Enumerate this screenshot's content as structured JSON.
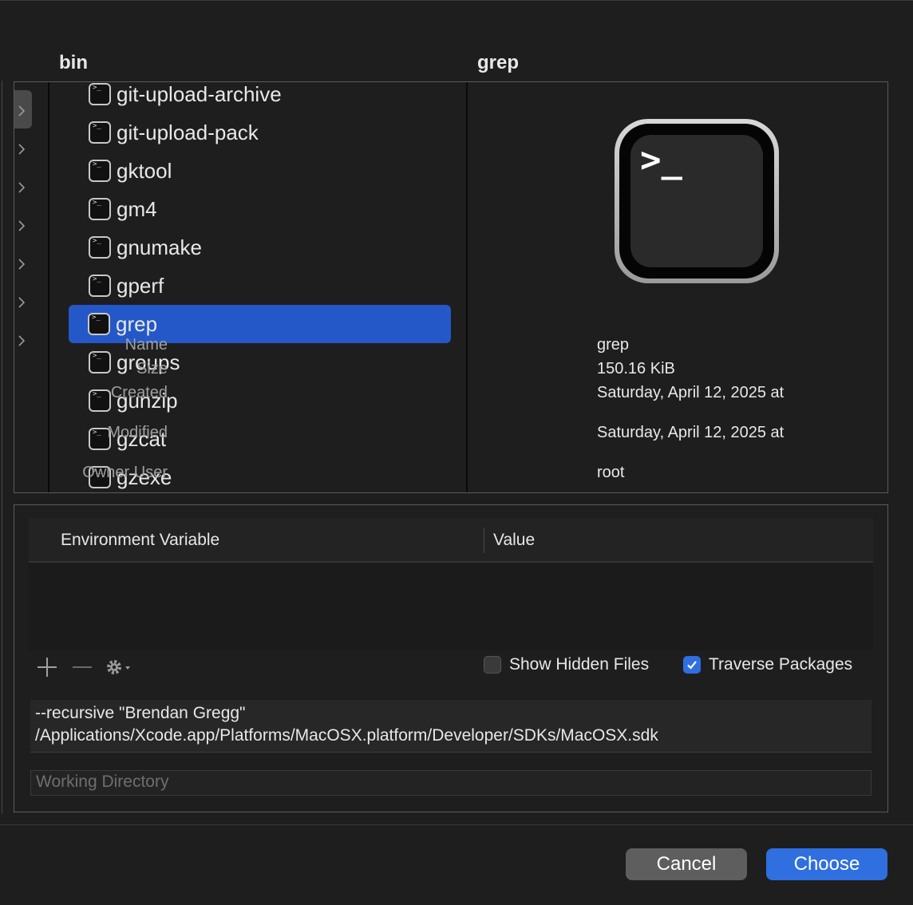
{
  "columns": {
    "left_header": "bin",
    "right_header": "grep"
  },
  "files": [
    {
      "name": "git-upload-archive",
      "selected": false
    },
    {
      "name": "git-upload-pack",
      "selected": false
    },
    {
      "name": "gktool",
      "selected": false
    },
    {
      "name": "gm4",
      "selected": false
    },
    {
      "name": "gnumake",
      "selected": false
    },
    {
      "name": "gperf",
      "selected": false
    },
    {
      "name": "grep",
      "selected": true
    },
    {
      "name": "groups",
      "selected": false
    },
    {
      "name": "gunzip",
      "selected": false
    },
    {
      "name": "gzcat",
      "selected": false
    },
    {
      "name": "gzexe",
      "selected": false
    }
  ],
  "preview": {
    "icon": "terminal-exec-icon",
    "icon_text": ">_",
    "meta": [
      {
        "label": "Name",
        "value": "grep"
      },
      {
        "label": "Size",
        "value": "150.16 KiB"
      },
      {
        "label": "Created",
        "value": "Saturday, April 12, 2025 at"
      },
      {
        "label": "Modified",
        "value": "Saturday, April 12, 2025 at"
      },
      {
        "label": "Owner User",
        "value": "root"
      }
    ]
  },
  "env_table": {
    "col_variable": "Environment Variable",
    "col_value": "Value"
  },
  "options": {
    "show_hidden_files": {
      "label": "Show Hidden Files",
      "checked": false
    },
    "traverse_packages": {
      "label": "Traverse Packages",
      "checked": true
    }
  },
  "arguments": {
    "value": "--recursive \"Brendan Gregg\" /Applications/Xcode.app/Platforms/MacOSX.platform/Developer/SDKs/MacOSX.sdk"
  },
  "working_directory": {
    "placeholder": "Working Directory"
  },
  "buttons": {
    "cancel": "Cancel",
    "choose": "Choose"
  },
  "colors": {
    "accent": "#2f6fe0",
    "selection": "#2458c9"
  }
}
